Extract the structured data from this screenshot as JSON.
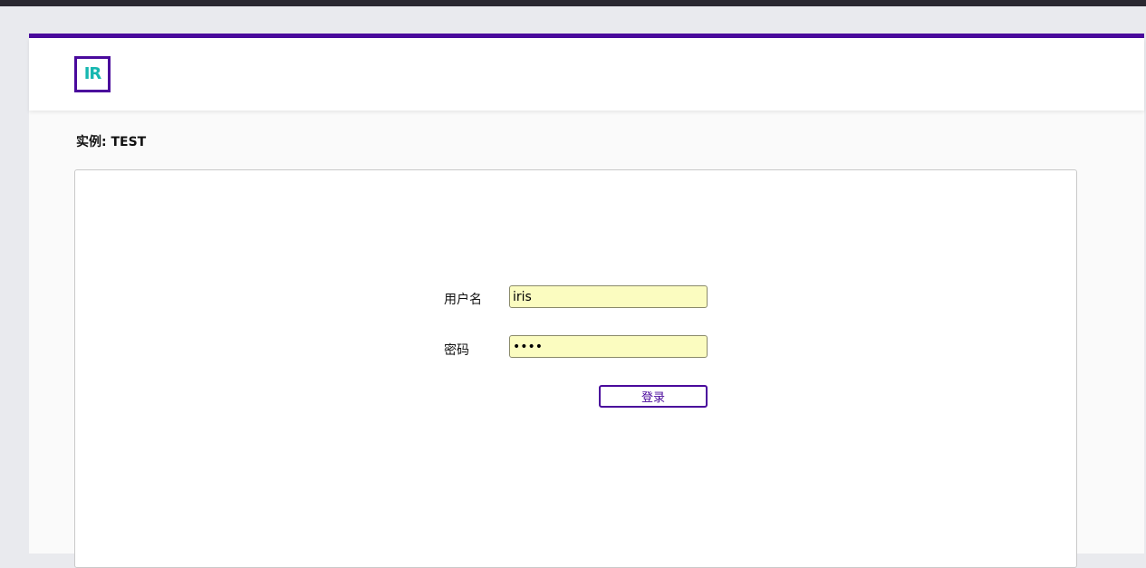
{
  "header": {
    "logo_text": "IR"
  },
  "instance": {
    "label": "实例:",
    "value": "TEST"
  },
  "login_form": {
    "username_label": "用户名",
    "username_value": "iris",
    "password_label": "密码",
    "password_value": "iris",
    "submit_label": "登录"
  },
  "colors": {
    "brand_purple": "#4a0a9c",
    "logo_teal": "#16b7b0",
    "input_background": "#fbfcc0"
  }
}
